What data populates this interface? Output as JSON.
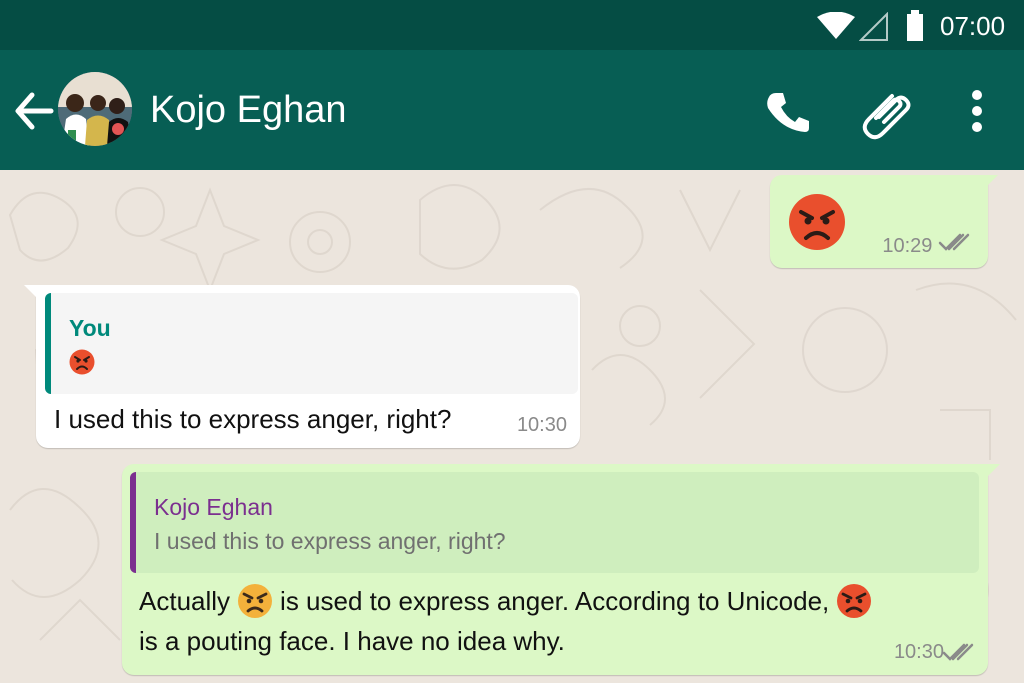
{
  "status_bar": {
    "time": "07:00",
    "icons": [
      "wifi-icon",
      "signal-icon",
      "battery-icon"
    ]
  },
  "header": {
    "contact_name": "Kojo Eghan",
    "icons": [
      "back-arrow-icon",
      "contact-avatar",
      "phone-icon",
      "paperclip-icon",
      "more-vertical-icon"
    ]
  },
  "colors": {
    "status_bar": "#054d44",
    "header": "#075e54",
    "outgoing_bubble": "#dcf8c6",
    "incoming_bubble": "#ffffff",
    "quote_author_you": "#00897b",
    "quote_author_contact": "#7b2f8f"
  },
  "messages": [
    {
      "direction": "outgoing",
      "emoji": "pouting-face-emoji",
      "time": "10:29",
      "status": "double-check-icon"
    },
    {
      "direction": "incoming",
      "quote": {
        "author": "You",
        "emoji": "pouting-face-emoji"
      },
      "text": "I used this to express anger, right?",
      "time": "10:30"
    },
    {
      "direction": "outgoing",
      "quote": {
        "author": "Kojo Eghan",
        "text": "I used this to express anger, right?"
      },
      "text_parts": [
        "Actually",
        "is used to express anger. According to Unicode,",
        "is a pouting face. I have no idea why."
      ],
      "emojis": [
        "angry-face-emoji",
        "pouting-face-emoji"
      ],
      "time": "10:30",
      "status": "double-check-icon"
    }
  ]
}
